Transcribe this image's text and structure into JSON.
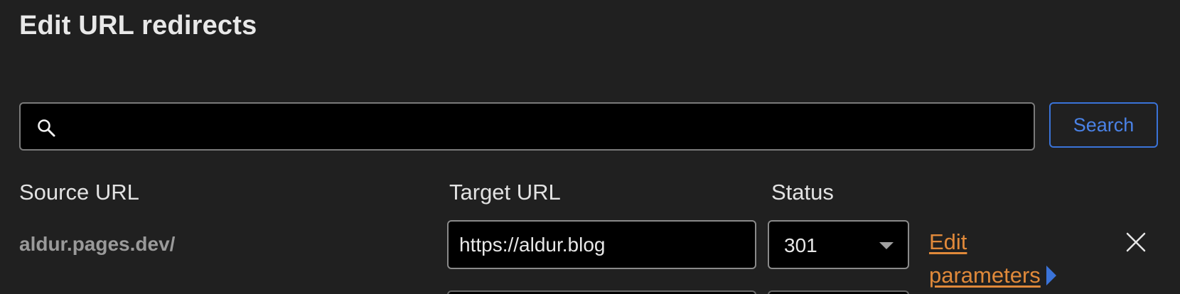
{
  "page": {
    "title": "Edit URL redirects"
  },
  "search": {
    "value": "",
    "placeholder": "",
    "button_label": "Search",
    "icon": "search-icon"
  },
  "table": {
    "columns": {
      "source": "Source URL",
      "target": "Target URL",
      "status": "Status"
    },
    "rows": [
      {
        "source": "aldur.pages.dev/",
        "target": "https://aldur.blog",
        "status": "301",
        "edit_label_line1": "Edit",
        "edit_label_line2": "parameters",
        "remove_icon": "close-icon"
      }
    ]
  },
  "colors": {
    "background": "#202020",
    "accent_blue": "#3a73d8",
    "link_orange": "#e0893a"
  }
}
